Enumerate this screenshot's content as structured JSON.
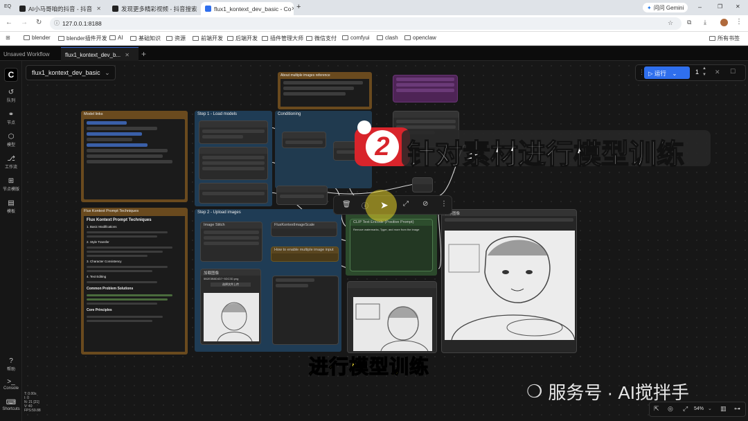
{
  "browser": {
    "tabs": [
      {
        "title": "AI小马哥咱的抖音 - 抖音",
        "active": false
      },
      {
        "title": "发现更多精彩视频 - 抖音搜索",
        "active": false
      },
      {
        "title": "flux1_kontext_dev_basic - Co",
        "active": true
      }
    ],
    "new_tab": "+",
    "gemini_label": "问问 Gemini",
    "url": "127.0.0.1:8188",
    "bookmarks": [
      "blender",
      "blender插件开发",
      "AI",
      "基础知识",
      "资源",
      "前端开发",
      "后端开发",
      "插件管理大师",
      "微信支付",
      "comfyui",
      "clash",
      "openclaw"
    ],
    "all_bookmarks": "所有书签"
  },
  "app": {
    "tabs": [
      "Unsaved Workflow",
      "flux1_kontext_dev_b..."
    ],
    "workflow_name": "flux1_kontext_dev_basic",
    "run_label": "运行",
    "run_count": "1",
    "sidebar": [
      {
        "icon": "queue-icon",
        "glyph": "↺",
        "label": "队列"
      },
      {
        "icon": "node-library-icon",
        "glyph": "⚭",
        "label": "节点"
      },
      {
        "icon": "model-library-icon",
        "glyph": "⬡",
        "label": "模型"
      },
      {
        "icon": "workflow-icon",
        "glyph": "⎇",
        "label": "工作流"
      },
      {
        "icon": "templates-icon",
        "glyph": "⊞",
        "label": "节点模版"
      },
      {
        "icon": "template-icon",
        "glyph": "▤",
        "label": "模板"
      }
    ],
    "sidebar_bottom": [
      {
        "icon": "help-icon",
        "glyph": "?",
        "label": "帮助"
      },
      {
        "icon": "console-icon",
        "glyph": ">_",
        "label": "Console"
      },
      {
        "icon": "shortcuts-icon",
        "glyph": "⌨",
        "label": "Shortcuts"
      }
    ],
    "stats": [
      "T: 0.00s",
      "I: 0",
      "N: 21 [21]",
      "V: 40",
      "FPS:59.88"
    ],
    "zoom": "54%"
  },
  "canvas": {
    "groups": {
      "model_links": "Model links",
      "load_models": "Step 1 - Load models",
      "conditioning": "Conditioning",
      "about_images": "About multiple images reference",
      "prompt_techniques": "Flux Kontext Prompt Techniques",
      "upload_images": "Step 2 - Upload images"
    },
    "nodes": {
      "clip_text_encode": "CLIP Text Encode (Positive Prompt)",
      "image_stitch": "Image Stitch",
      "flux_scale": "FluxKontextImageScale",
      "load_image": "加载图像",
      "multi_image_note": "How to enable multiple image input",
      "save_image": "保存图像",
      "prompt_text": "Remove watermarks, Tyger, and more from the image"
    },
    "prompt_doc": {
      "title": "Flux Kontext Prompt Techniques",
      "h1": "1. Basic Modifications",
      "h2": "2. Style Transfer",
      "h3": "3. Character Consistency",
      "h4": "4. Text Editing",
      "h5": "Common Problem Solutions",
      "h6": "Core Principles"
    },
    "load_image_file": "5B2E3B8D4D7~5DC3D.png",
    "upload_label": "选择文件上传"
  },
  "overlay": {
    "badge_number": "2",
    "title": "针对素材进行模型训练",
    "subtitle": "进行模型训练",
    "watermark": "服务号 · AI搅拌手"
  },
  "colors": {
    "accent_blue": "#2f6fed",
    "badge_red": "#d8242b",
    "subtitle_yellow": "#ffe83a",
    "group_orange": "#6a4a1e",
    "group_blue": "#1f3c55",
    "group_green": "#2c4a2c",
    "group_purple": "#4e2456"
  }
}
